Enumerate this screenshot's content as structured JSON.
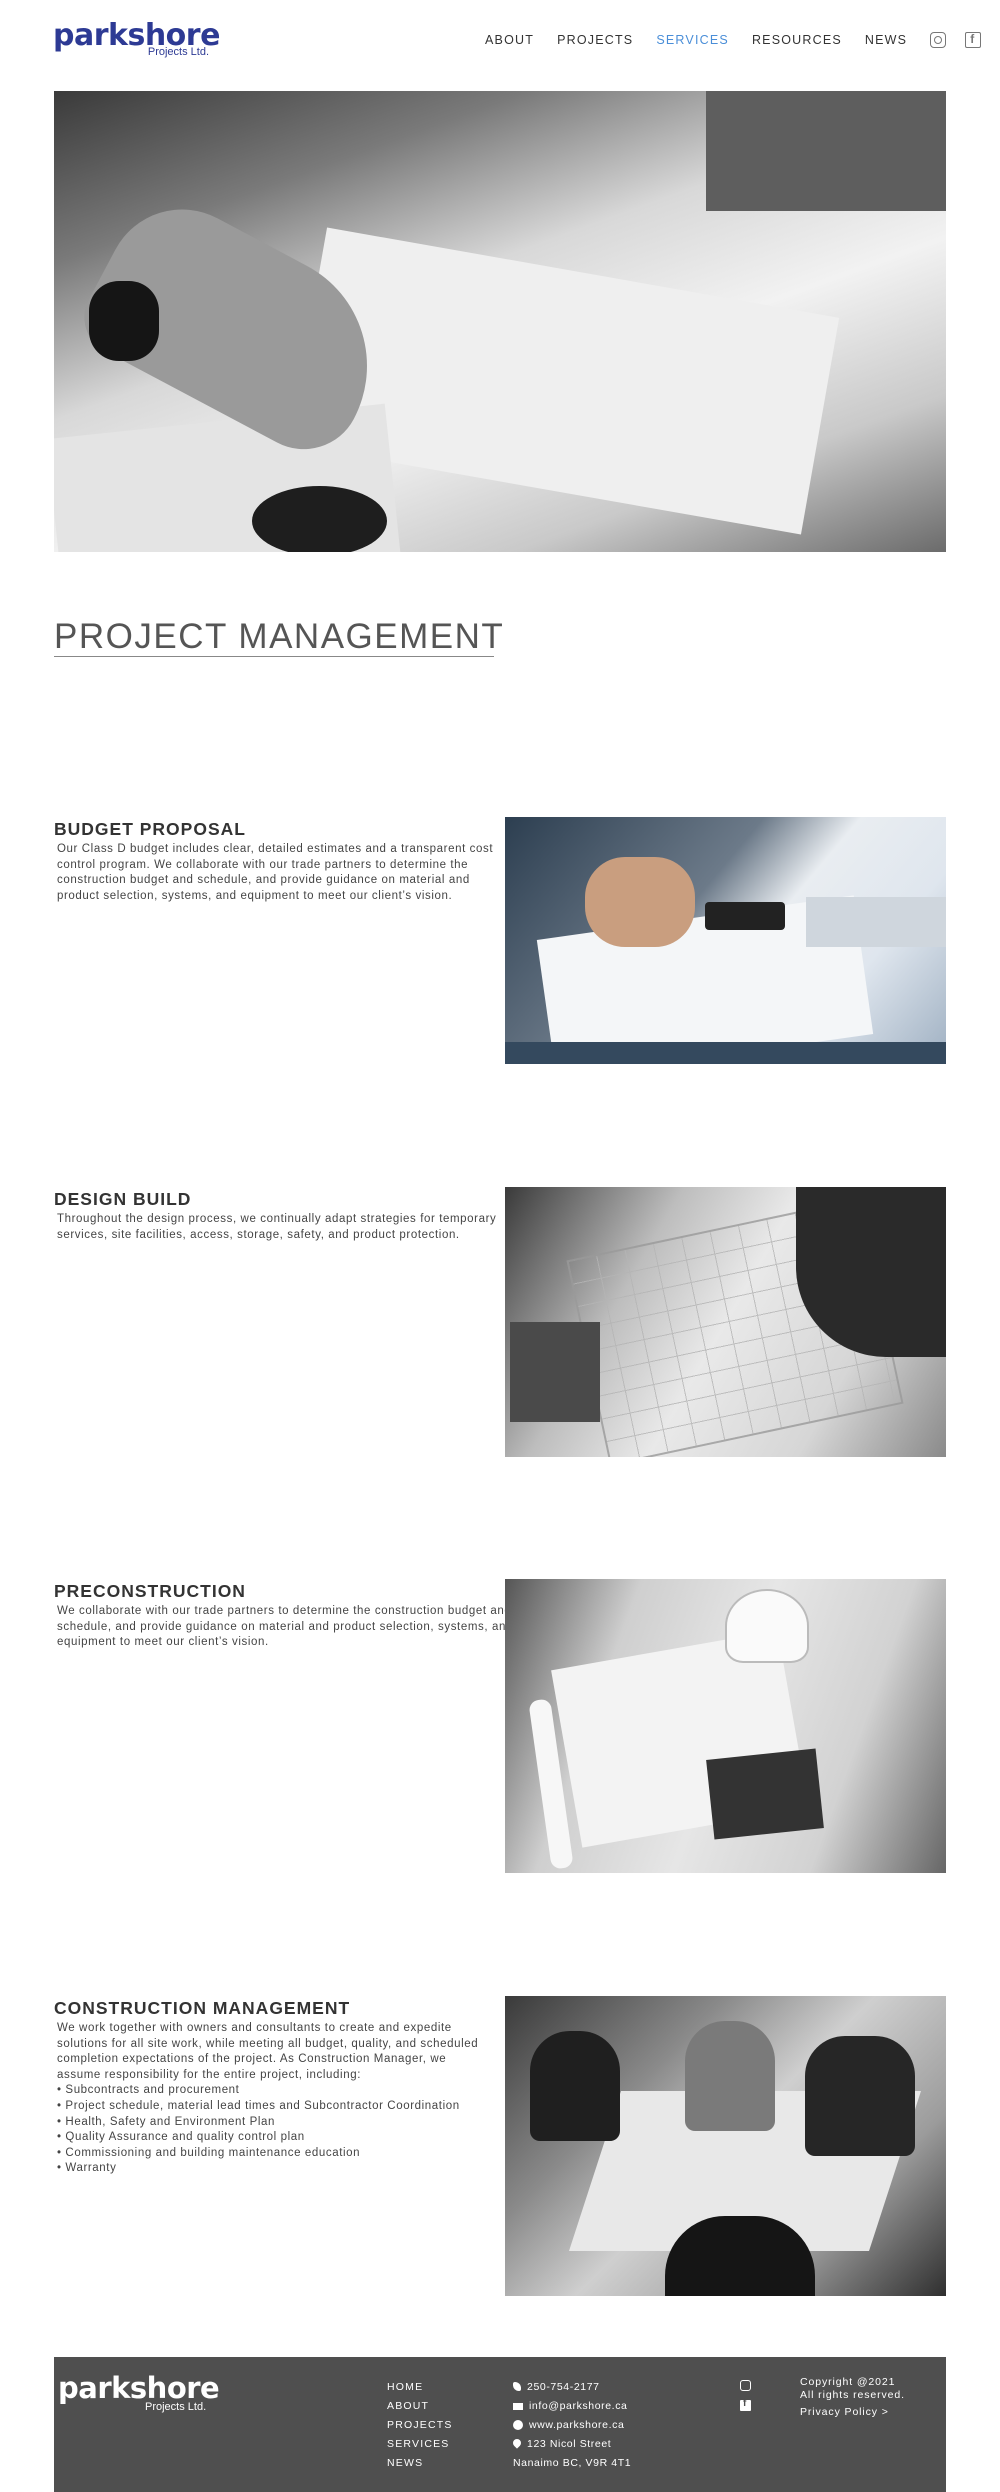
{
  "brand": {
    "name": "parkshore",
    "sub": "Projects Ltd.",
    "color": "#2d3a94"
  },
  "nav": {
    "items": [
      {
        "label": "ABOUT"
      },
      {
        "label": "PROJECTS"
      },
      {
        "label": "SERVICES",
        "active": true
      },
      {
        "label": "RESOURCES"
      },
      {
        "label": "NEWS"
      }
    ],
    "icons": [
      "instagram-icon",
      "facebook-icon"
    ],
    "active_color": "#4a8ed8"
  },
  "page": {
    "title": "PROJECT MANAGEMENT"
  },
  "sections": [
    {
      "title": "BUDGET PROPOSAL",
      "body": "Our Class D budget includes clear, detailed estimates and a transparent cost control program. We collaborate with our trade partners to determine the construction budget and schedule, and provide guidance on material and product selection, systems, and equipment to meet our client’s vision."
    },
    {
      "title": "DESIGN BUILD",
      "body": "Throughout the design process, we continually adapt strategies for temporary services, site facilities, access, storage, safety, and product protection."
    },
    {
      "title": "PRECONSTRUCTION",
      "body": "We collaborate with our trade partners to determine the construction budget and schedule, and provide guidance on material and product selection, systems, and equipment to meet our client’s vision."
    },
    {
      "title": "CONSTRUCTION MANAGEMENT",
      "body": "We work together with owners and consultants to create and expedite solutions for all site work, while meeting all budget, quality, and scheduled completion expectations of the project. As Construction Manager, we assume responsibility for the entire project, including:",
      "list": [
        "• Subcontracts and procurement",
        "• Project schedule, material lead times and Subcontractor Coordination",
        "• Health, Safety and Environment Plan",
        "• Quality Assurance and quality control plan",
        "• Commissioning and building maintenance education",
        "• Warranty"
      ]
    }
  ],
  "footer": {
    "brand": "parkshore",
    "brand_sub": "Projects Ltd.",
    "links": [
      "HOME",
      "ABOUT",
      "PROJECTS",
      "SERVICES",
      "NEWS"
    ],
    "phone": "250-754-2177",
    "email": "info@parkshore.ca",
    "web": "www.parkshore.ca",
    "address_line1": "123 Nicol Street",
    "address_line2": "Nanaimo BC, V9R 4T1",
    "copyright_line1": "Copyright @2021",
    "copyright_line2": "All rights reserved.",
    "privacy": "Privacy Policy >",
    "bg_color": "#4f4f4f"
  }
}
